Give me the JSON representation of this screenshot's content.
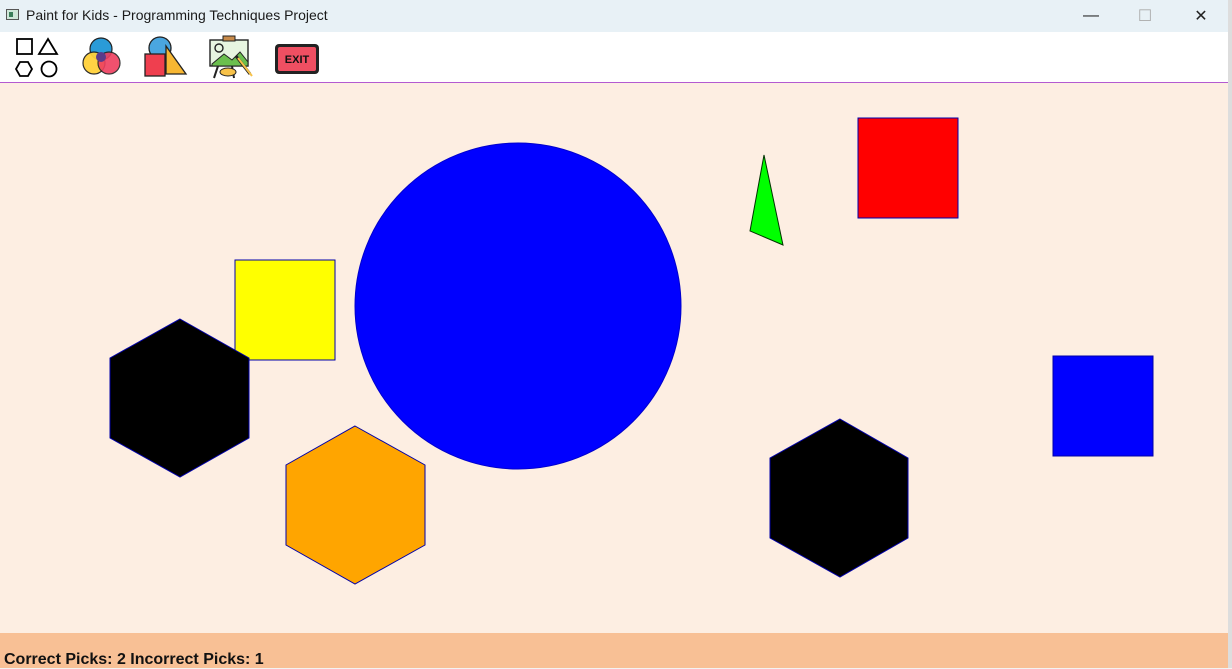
{
  "window": {
    "title": "Paint for Kids - Programming Techniques Project",
    "controls": {
      "minimize": "—",
      "maximize": "☐",
      "close": "✕"
    }
  },
  "toolbar": {
    "items": [
      {
        "name": "shapes-menu",
        "icon": "shapes-icon"
      },
      {
        "name": "colors-menu",
        "icon": "color-circles-icon"
      },
      {
        "name": "pick-by-shape-color",
        "icon": "shape-color-mix-icon"
      },
      {
        "name": "picture-mode",
        "icon": "paint-easel-icon"
      },
      {
        "name": "exit",
        "icon": "exit-sign-icon",
        "label": "EXIT"
      }
    ]
  },
  "canvas": {
    "background": "#fdeee2",
    "shapes": [
      {
        "type": "circle",
        "fill": "#0000ff"
      },
      {
        "type": "triangle",
        "fill": "#00ff00"
      },
      {
        "type": "square",
        "fill": "#ff0000"
      },
      {
        "type": "square",
        "fill": "#ffff00"
      },
      {
        "type": "square",
        "fill": "#0000ff"
      },
      {
        "type": "hexagon",
        "fill": "#000000"
      },
      {
        "type": "hexagon",
        "fill": "#ffa500"
      },
      {
        "type": "hexagon",
        "fill": "#000000"
      }
    ]
  },
  "status": {
    "text": "Correct Picks: 2 Incorrect Picks: 1"
  }
}
